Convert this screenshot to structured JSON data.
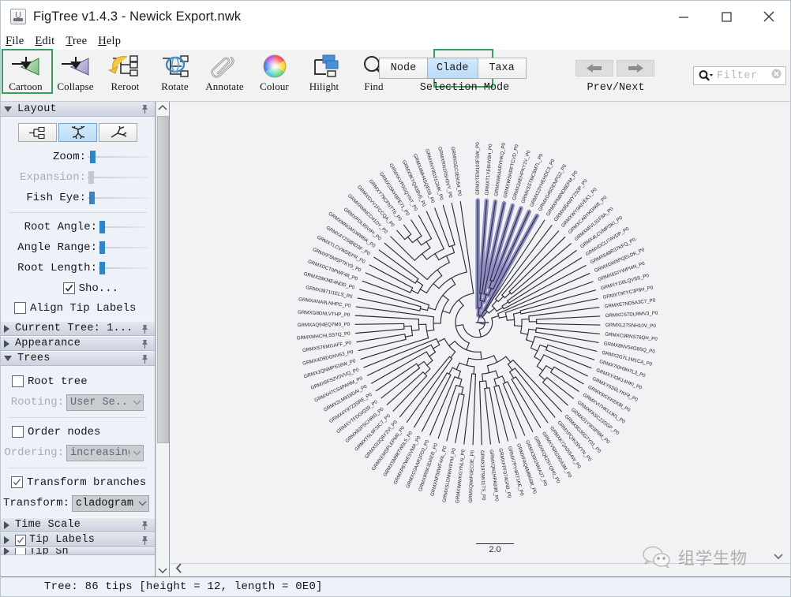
{
  "window": {
    "title": "FigTree v1.4.3 - Newick Export.nwk",
    "app_icon": "figtree-app-icon",
    "minimize": "minimize-icon",
    "maximize": "maximize-icon",
    "close": "close-icon"
  },
  "menubar": {
    "items": [
      {
        "label": "File",
        "mnemonic": "F",
        "rest": "ile"
      },
      {
        "label": "Edit",
        "mnemonic": "E",
        "rest": "dit"
      },
      {
        "label": "Tree",
        "mnemonic": "T",
        "rest": "ree"
      },
      {
        "label": "Help",
        "mnemonic": "H",
        "rest": "elp"
      }
    ]
  },
  "toolbar": {
    "buttons": [
      {
        "label": "Cartoon",
        "icon": "cartoon-icon",
        "highlighted": true
      },
      {
        "label": "Collapse",
        "icon": "collapse-icon",
        "highlighted": false
      },
      {
        "label": "Reroot",
        "icon": "reroot-icon",
        "highlighted": false
      },
      {
        "label": "Rotate",
        "icon": "rotate-icon",
        "highlighted": false
      },
      {
        "label": "Annotate",
        "icon": "annotate-icon",
        "highlighted": false
      },
      {
        "label": "Colour",
        "icon": "colour-wheel-icon",
        "highlighted": false
      },
      {
        "label": "Hilight",
        "icon": "hilight-icon",
        "highlighted": false
      },
      {
        "label": "Find",
        "icon": "find-icon",
        "highlighted": false
      }
    ],
    "selection_mode": {
      "group_label": "Selection Mode",
      "options": [
        "Node",
        "Clade",
        "Taxa"
      ],
      "selected": "Clade",
      "highlighted": "Clade"
    },
    "navigation": {
      "group_label": "Prev/Next",
      "prev_icon": "arrow-left-icon",
      "next_icon": "arrow-right-icon"
    },
    "filter": {
      "icon": "search-icon",
      "placeholder": "Filter",
      "value": "",
      "clear_icon": "clear-circle-icon"
    }
  },
  "sidebar": {
    "layout": {
      "title": "Layout",
      "expanded": true,
      "pin_icon": "pin-icon",
      "layout_buttons": [
        {
          "name": "rectangular-layout",
          "selected": false
        },
        {
          "name": "polar-layout",
          "selected": true
        },
        {
          "name": "radial-layout",
          "selected": false
        }
      ],
      "sliders": [
        {
          "label": "Zoom:",
          "value": 6,
          "enabled": true
        },
        {
          "label": "Expansion:",
          "value": 2,
          "enabled": false
        },
        {
          "label": "Fish Eye:",
          "value": 4,
          "enabled": true
        },
        {
          "label": "Root Angle:",
          "value": 2,
          "enabled": true
        },
        {
          "label": "Angle Range:",
          "value": 2,
          "enabled": true
        },
        {
          "label": "Root Length:",
          "value": 2,
          "enabled": true
        }
      ],
      "checkboxes": [
        {
          "label": "Sho...",
          "checked": true,
          "enabled": true,
          "align": "right"
        },
        {
          "label": "Align Tip Labels",
          "checked": false,
          "enabled": true,
          "align": "left"
        }
      ]
    },
    "sections": [
      {
        "title": "Current Tree: 1...",
        "expanded": false,
        "pin_icon": "pin-icon"
      },
      {
        "title": "Appearance",
        "expanded": false,
        "pin_icon": "pin-icon"
      },
      {
        "title": "Trees",
        "expanded": true,
        "pin_icon": "pin-icon"
      }
    ],
    "trees": {
      "root_tree": {
        "label": "Root tree",
        "checked": false
      },
      "rooting": {
        "label": "Rooting:",
        "value": "User Se...",
        "enabled": false
      },
      "order_nodes": {
        "label": "Order nodes",
        "checked": false
      },
      "ordering": {
        "label": "Ordering:",
        "value": "increasing",
        "enabled": false
      },
      "transform_branches": {
        "label": "Transform branches",
        "checked": true
      },
      "transform": {
        "label": "Transform:",
        "value": "cladogram",
        "enabled": true
      }
    },
    "bottom_sections": [
      {
        "title": "Time Scale",
        "expanded": false,
        "checkbox": null,
        "pin_icon": "pin-icon"
      },
      {
        "title": "Tip Labels",
        "expanded": false,
        "checkbox": true,
        "pin_icon": "pin-icon"
      }
    ],
    "scrollbar": {
      "up_icon": "chevron-up-icon",
      "down_icon": "chevron-down-icon"
    }
  },
  "tree_panel": {
    "scale_bar": {
      "label": "2.0"
    },
    "hscroll_left_icon": "chevron-left-icon",
    "watermark": {
      "icon": "wechat-icon",
      "text": "组学生物"
    },
    "collapse_caret": "chevron-down-icon"
  },
  "statusbar": {
    "text": "Tree: 86 tips [height = 12, length = 0E0]"
  },
  "chart_data": {
    "type": "tree",
    "layout": "polar",
    "transform": "cladogram",
    "n_tips": 86,
    "height": 12,
    "length": "0E0",
    "scale_bar": 2.0,
    "branch_color": "#2b2b3d",
    "highlight_color": "#8d8dc4",
    "highlighted_clade_tips": 8,
    "center": [
      390,
      280
    ],
    "tip_radius": 155,
    "label_radius": 162,
    "start_angle": -92,
    "sweep": 356
  }
}
